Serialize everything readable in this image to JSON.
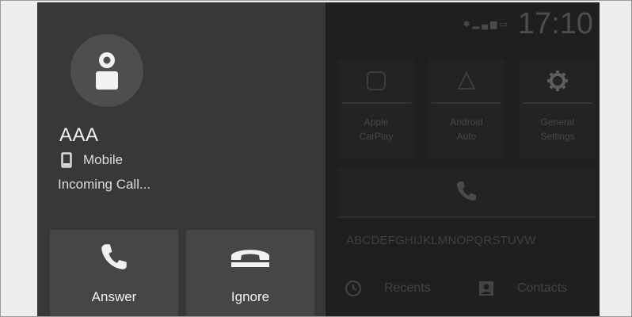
{
  "status_bar": {
    "icons": [
      "bluetooth-icon",
      "signal-icon",
      "battery-icon"
    ],
    "time": "17:10"
  },
  "home": {
    "tiles": [
      {
        "label_line1": "Apple",
        "label_line2": "CarPlay",
        "icon": "carplay-icon"
      },
      {
        "label_line1": "Android",
        "label_line2": "Auto",
        "icon": "android-auto-icon"
      },
      {
        "label_line1": "General",
        "label_line2": "Settings",
        "icon": "gear-icon"
      }
    ],
    "phone_icon": "phone-icon",
    "alphabet": "ABCDEFGHIJKLMNOPQRSTUVW",
    "bottom": {
      "recents_label": "Recents",
      "contacts_label": "Contacts"
    }
  },
  "call": {
    "caller_name": "AAA",
    "line_type": "Mobile",
    "status": "Incoming Call...",
    "answer_label": "Answer",
    "ignore_label": "Ignore"
  },
  "colors": {
    "overlay_bg": "#383838",
    "button_bg": "#464646",
    "text": "#f2f2f2"
  }
}
